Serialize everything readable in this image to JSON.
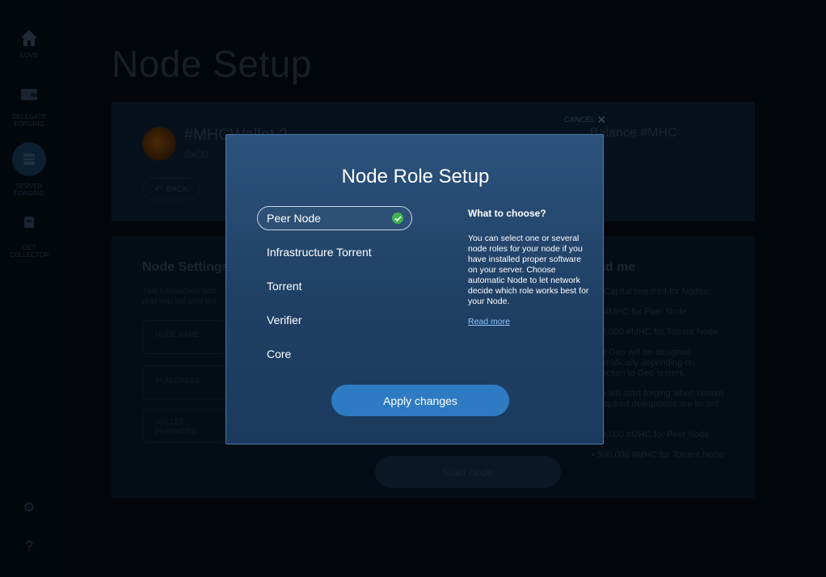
{
  "sidebar": {
    "items": [
      {
        "label": "LOVE",
        "icon": "home-icon"
      },
      {
        "label": "DELEGATE FORGING",
        "icon": "delegate-icon"
      },
      {
        "label": "SERVER FORGING",
        "icon": "server-icon"
      },
      {
        "label": "GET COLLECTOR",
        "icon": "collector-icon"
      }
    ],
    "settings_icon": "gear-icon",
    "help_glyph": "?"
  },
  "page": {
    "title": "Node Setup",
    "wallet": {
      "name": "#MHCWallet 2",
      "address": "0x00",
      "back_label": "BACK",
      "balance_title": "Balance #MHC"
    },
    "settings": {
      "title": "Node Settings",
      "description": "This transaction acts until you will stop the",
      "fields": [
        {
          "label": "NODE NAME"
        },
        {
          "label": "IP-ADDRESS"
        },
        {
          "label": "WALLET PASSWORD"
        }
      ],
      "start_label": "Start node"
    },
    "readme": {
      "title": "ad me",
      "lines": [
        "d Capital required for Nodes:",
        "0 #MHC for Peer Node",
        "00,000 #MHC for Torrent Node",
        "de Geo will be assigned tomatically depending on nection to Geo testers.",
        "de will start forging when nimum required delegations are lected:",
        "00,000 #MHC for Peer Node",
        "• 500,000 #MHC for Torrent Node"
      ]
    }
  },
  "modal": {
    "cancel_label": "CANCEL",
    "close_glyph": "✕",
    "title": "Node Role Setup",
    "roles": [
      {
        "label": "Peer Node",
        "selected": true
      },
      {
        "label": "Infrastructure Torrent",
        "selected": false
      },
      {
        "label": "Torrent",
        "selected": false
      },
      {
        "label": "Verifier",
        "selected": false
      },
      {
        "label": "Core",
        "selected": false
      }
    ],
    "info": {
      "title": "What to choose?",
      "text": "You can select one or several node roles for your node if you have installed proper software on your server. Choose automatic Node to let network decide which role works best for your Node.",
      "link": "Read more"
    },
    "apply_label": "Apply changes"
  },
  "colors": {
    "accent": "#2e7bc4",
    "selected_check": "#3fb34f",
    "modal_top": "#2c537d",
    "modal_bottom": "#1b3a5e",
    "link": "#8fc7ff"
  }
}
